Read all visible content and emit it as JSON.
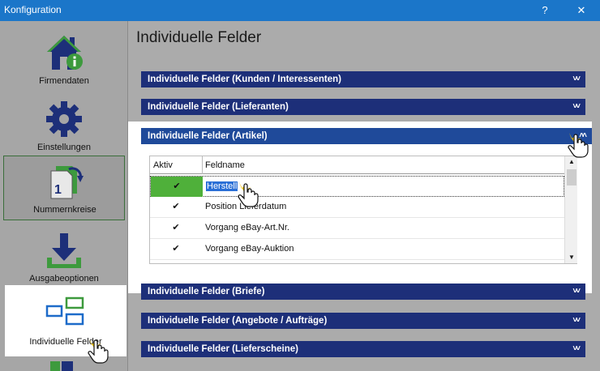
{
  "window": {
    "title": "Konfiguration",
    "help": "?",
    "close": "✕"
  },
  "sidebar": {
    "items": [
      {
        "label": "Firmendaten",
        "icon": "home-info-icon"
      },
      {
        "label": "Einstellungen",
        "icon": "gear-icon"
      },
      {
        "label": "Nummernkreise",
        "icon": "number-refresh-icon"
      },
      {
        "label": "Ausgabeoptionen",
        "icon": "download-tray-icon"
      },
      {
        "label": "Individuelle Felder",
        "icon": "fields-icon"
      }
    ]
  },
  "main": {
    "title": "Individuelle Felder",
    "sections": [
      {
        "label": "Individuelle Felder (Kunden / Interessenten)"
      },
      {
        "label": "Individuelle Felder (Lieferanten)"
      },
      {
        "label": "Individuelle Felder (Artikel)"
      },
      {
        "label": "Individuelle Felder (Briefe)"
      },
      {
        "label": "Individuelle Felder (Angebote / Aufträge)"
      },
      {
        "label": "Individuelle Felder (Lieferscheine)"
      }
    ],
    "grid": {
      "headers": {
        "aktiv": "Aktiv",
        "feldname": "Feldname"
      },
      "rows": [
        {
          "checked": "✔",
          "name": "Herstell"
        },
        {
          "checked": "✔",
          "name": "Position Lieferdatum"
        },
        {
          "checked": "✔",
          "name": "Vorgang eBay-Art.Nr."
        },
        {
          "checked": "✔",
          "name": "Vorgang eBay-Auktion"
        }
      ]
    }
  },
  "colors": {
    "titlebar": "#1b76c9",
    "section_header": "#1d2f79",
    "selected_cell": "#4fb03a"
  }
}
